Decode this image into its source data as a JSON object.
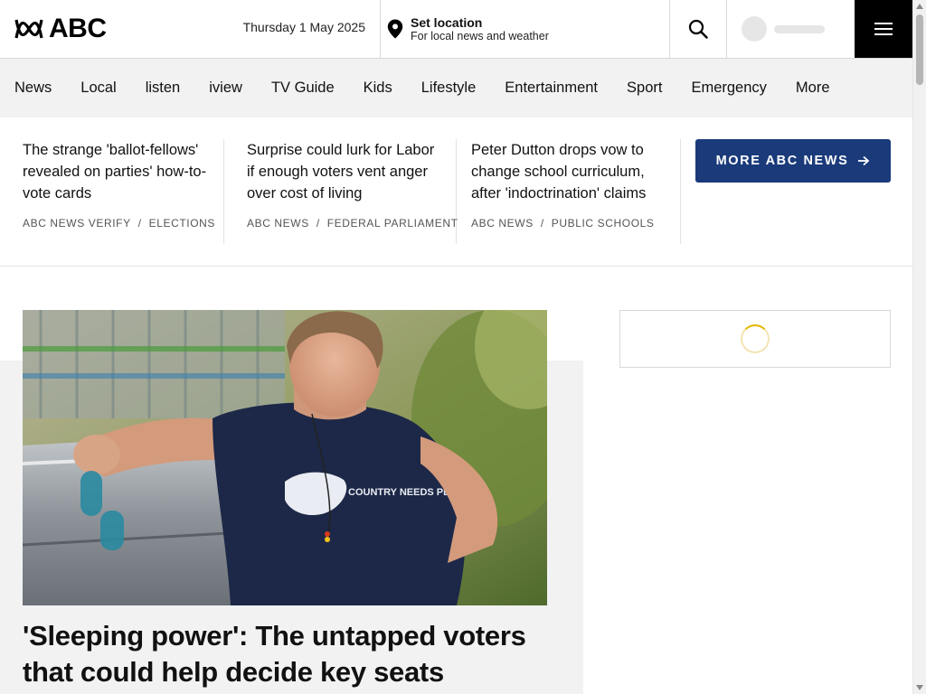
{
  "header": {
    "logo_text": "ABC",
    "date": "Thursday 1 May 2025",
    "location": {
      "title": "Set location",
      "subtitle": "For local news and weather"
    },
    "icons": [
      "abc-lissajous-logo-icon",
      "location-pin-icon",
      "search-icon",
      "avatar-placeholder",
      "hamburger-menu-icon"
    ]
  },
  "nav": {
    "items": [
      "News",
      "Local",
      "listen",
      "iview",
      "TV Guide",
      "Kids",
      "Lifestyle",
      "Entertainment",
      "Sport",
      "Emergency",
      "More"
    ]
  },
  "top_stories": [
    {
      "title": "The strange 'ballot-fellows' revealed on parties' how-to-vote cards",
      "source": "ABC NEWS VERIFY",
      "topic": "ELECTIONS"
    },
    {
      "title": "Surprise could lurk for Labor if enough voters vent anger over cost of living",
      "source": "ABC NEWS",
      "topic": "FEDERAL PARLIAMENT"
    },
    {
      "title": "Peter Dutton drops vow to change school curriculum, after 'indoctrination' claims",
      "source": "ABC NEWS",
      "topic": "PUBLIC SCHOOLS"
    }
  ],
  "meta_separator": "/",
  "more_button": {
    "label": "MORE ABC NEWS",
    "icon": "arrow-right-icon"
  },
  "feature": {
    "title": "'Sleeping power': The untapped voters that could help decide key seats",
    "image_text": "COUNTRY NEEDS PEOPLE"
  },
  "colors": {
    "accent_blue": "#1a3a7a",
    "nav_bg": "#f2f2f2",
    "menu_bg": "#000000",
    "spinner": "#e6b800"
  }
}
